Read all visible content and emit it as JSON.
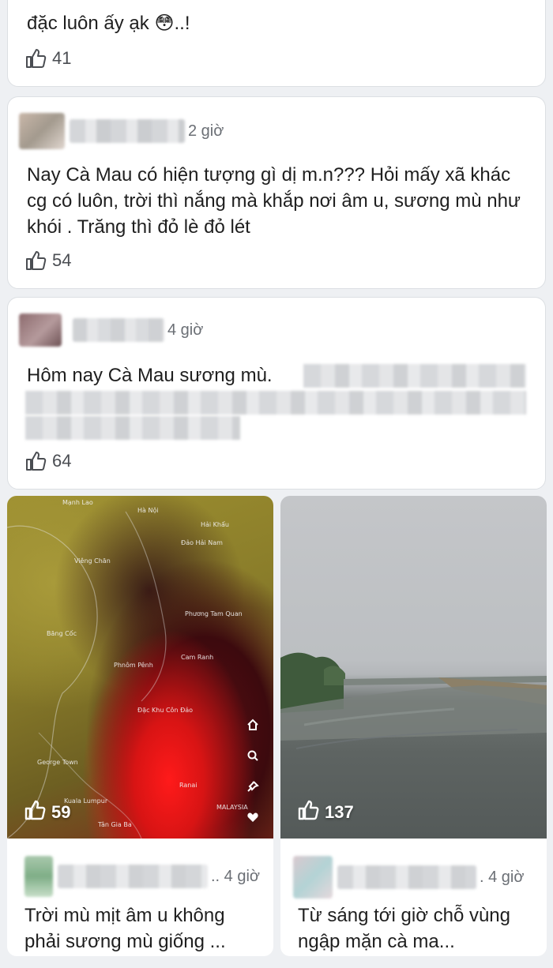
{
  "post0": {
    "text": "đặc luôn ấy ạk",
    "emoji": "😳",
    "text_suffix": "..!",
    "likes": "41"
  },
  "post1": {
    "time": "2 giờ",
    "text": "Nay Cà Mau có hiện tượng gì dị m.n??? Hỏi mấy xã khác cg có luôn, trời thì nắng mà khắp nơi âm u, sương mù như khói . Trăng thì đỏ lè đỏ lét",
    "likes": "54"
  },
  "post2": {
    "time": "4 giờ",
    "text": "Hôm nay Cà Mau sương mù.",
    "likes": "64"
  },
  "tile_left": {
    "likes": "59",
    "time": "4 giờ",
    "text": "Trời mù mịt âm u không phải sương mù giống ...",
    "map_labels": [
      {
        "text": "Mạnh Lao"
      },
      {
        "text": "Hà Nội"
      },
      {
        "text": "Hải Khẩu"
      },
      {
        "text": "Đảo Hải Nam"
      },
      {
        "text": "Viêng Chăn"
      },
      {
        "text": "Phương Tam Quan"
      },
      {
        "text": "Băng Cốc"
      },
      {
        "text": "Cam Ranh"
      },
      {
        "text": "Phnôm Pênh"
      },
      {
        "text": "Đặc Khu Côn Đảo"
      },
      {
        "text": "George Town"
      },
      {
        "text": "Kuala Lumpur"
      },
      {
        "text": "Ranai"
      },
      {
        "text": "Tân Gia Ba"
      },
      {
        "text": "MALAYSIA"
      }
    ]
  },
  "tile_right": {
    "likes": "137",
    "time": "4 giờ",
    "text": "Từ sáng tới giờ chỗ vùng ngập mặn cà ma..."
  }
}
